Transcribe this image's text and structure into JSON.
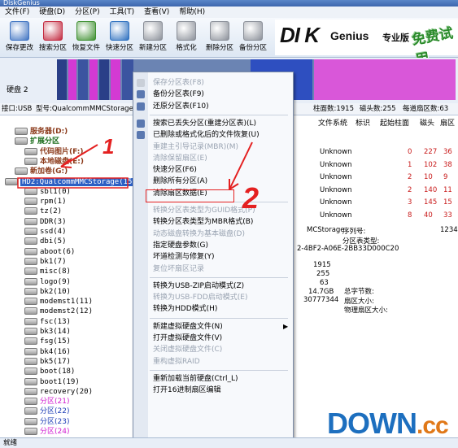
{
  "window": {
    "title": "DiskGenius"
  },
  "menubar": [
    "文件(F)",
    "硬盘(D)",
    "分区(P)",
    "工具(T)",
    "查看(V)",
    "帮助(H)"
  ],
  "toolbar": [
    {
      "label": "保存更改",
      "icon": "save-icon",
      "color": "#3f73c2"
    },
    {
      "label": "搜索分区",
      "icon": "search-partition-icon",
      "color": "#c2283e"
    },
    {
      "label": "恢复文件",
      "icon": "recover-files-icon",
      "color": "#3d8f2f"
    },
    {
      "label": "快速分区",
      "icon": "quick-partition-icon",
      "color": "#2c6fbf"
    },
    {
      "label": "新建分区",
      "icon": "new-partition-icon",
      "color": "#8a8f98"
    },
    {
      "label": "格式化",
      "icon": "format-icon",
      "color": "#8a8f98"
    },
    {
      "label": "删除分区",
      "icon": "delete-partition-icon",
      "color": "#8a8f98"
    },
    {
      "label": "备份分区",
      "icon": "backup-partition-icon",
      "color": "#8a8f98"
    }
  ],
  "brand": {
    "dk": "DI K",
    "gen": "Genius",
    "pro": "专业版",
    "free": "免费试用"
  },
  "disk": {
    "label": "硬盘 2"
  },
  "infobar": {
    "iface": "接口:USB",
    "model": "型号:QualcommMMCStorage",
    "cyl": "柱面数:1915",
    "heads": "磁头数:255",
    "spt": "每道扇区数:63"
  },
  "tree": [
    {
      "text": "服务器(D:)",
      "cls": "c-brown",
      "indent": 18,
      "hd": true
    },
    {
      "text": "扩展分区",
      "cls": "c-green",
      "indent": 18,
      "hd": true
    },
    {
      "text": "代码图片(F:)",
      "cls": "c-brown",
      "indent": 30,
      "hd": true
    },
    {
      "text": "本地磁盘(E:)",
      "cls": "c-brown",
      "indent": 30,
      "hd": true
    },
    {
      "text": "新加卷(G:)",
      "cls": "c-brown",
      "indent": 18,
      "hd": true
    },
    {
      "text": "HD2:QualcommMMCStorage(15GB)",
      "cls": "c-mono",
      "indent": 6,
      "hd": true,
      "sel": true
    },
    {
      "text": "sbl1(0)",
      "cls": "c-mono",
      "indent": 30,
      "hd": true
    },
    {
      "text": "rpm(1)",
      "cls": "c-mono",
      "indent": 30,
      "hd": true
    },
    {
      "text": "tz(2)",
      "cls": "c-mono",
      "indent": 30,
      "hd": true
    },
    {
      "text": "DDR(3)",
      "cls": "c-mono",
      "indent": 30,
      "hd": true
    },
    {
      "text": "ssd(4)",
      "cls": "c-mono",
      "indent": 30,
      "hd": true
    },
    {
      "text": "dbi(5)",
      "cls": "c-mono",
      "indent": 30,
      "hd": true
    },
    {
      "text": "aboot(6)",
      "cls": "c-mono",
      "indent": 30,
      "hd": true
    },
    {
      "text": "bk1(7)",
      "cls": "c-mono",
      "indent": 30,
      "hd": true
    },
    {
      "text": "misc(8)",
      "cls": "c-mono",
      "indent": 30,
      "hd": true
    },
    {
      "text": "logo(9)",
      "cls": "c-mono",
      "indent": 30,
      "hd": true
    },
    {
      "text": "bk2(10)",
      "cls": "c-mono",
      "indent": 30,
      "hd": true
    },
    {
      "text": "modemst1(11)",
      "cls": "c-mono",
      "indent": 30,
      "hd": true
    },
    {
      "text": "modemst2(12)",
      "cls": "c-mono",
      "indent": 30,
      "hd": true
    },
    {
      "text": "fsc(13)",
      "cls": "c-mono",
      "indent": 30,
      "hd": true
    },
    {
      "text": "bk3(14)",
      "cls": "c-mono",
      "indent": 30,
      "hd": true
    },
    {
      "text": "fsg(15)",
      "cls": "c-mono",
      "indent": 30,
      "hd": true
    },
    {
      "text": "bk4(16)",
      "cls": "c-mono",
      "indent": 30,
      "hd": true
    },
    {
      "text": "bk5(17)",
      "cls": "c-mono",
      "indent": 30,
      "hd": true
    },
    {
      "text": "boot(18)",
      "cls": "c-mono",
      "indent": 30,
      "hd": true
    },
    {
      "text": "boot1(19)",
      "cls": "c-mono",
      "indent": 30,
      "hd": true
    },
    {
      "text": "recovery(20)",
      "cls": "c-mono",
      "indent": 30,
      "hd": true
    },
    {
      "text": "分区(21)",
      "cls": "c-mag",
      "indent": 30,
      "hd": true
    },
    {
      "text": "分区(22)",
      "cls": "c-blue",
      "indent": 30,
      "hd": true
    },
    {
      "text": "分区(23)",
      "cls": "c-blue",
      "indent": 30,
      "hd": true
    },
    {
      "text": "分区(24)",
      "cls": "c-mag",
      "indent": 30,
      "hd": true
    }
  ],
  "table": {
    "headers": [
      "文件系统",
      "标识",
      "起始柱面",
      "磁头",
      "扇区"
    ],
    "rows": [
      [
        "Unknown",
        "",
        "0",
        "227",
        "36"
      ],
      [
        "Unknown",
        "",
        "1",
        "102",
        "38"
      ],
      [
        "Unknown",
        "",
        "2",
        "10",
        "9"
      ],
      [
        "Unknown",
        "",
        "2",
        "140",
        "11"
      ],
      [
        "Unknown",
        "",
        "3",
        "145",
        "15"
      ],
      [
        "Unknown",
        "",
        "8",
        "40",
        "33"
      ]
    ]
  },
  "details": {
    "serial_label": "序列号:",
    "serial_value": "1234",
    "pt_label": "分区表类型:",
    "model_frag": "MCStorage",
    "guid_frag": "2-4BF2-A06E-2BB33D000C20",
    "cyl": "1915",
    "heads": "255",
    "spt": "63",
    "size": "14.7GB",
    "sectors": "30777344",
    "total_bytes_label": "总字节数:",
    "sector_size_label": "扇区大小:",
    "phys_sector_label": "物理扇区大小:"
  },
  "context_menu": [
    {
      "label": "保存分区表(F8)",
      "disabled": true,
      "icon": "save-icon"
    },
    {
      "label": "备份分区表(F9)",
      "disabled": false,
      "icon": "backup-icon"
    },
    {
      "label": "还原分区表(F10)",
      "disabled": false,
      "icon": "restore-icon"
    },
    {
      "sep": true
    },
    {
      "label": "搜索已丢失分区(重建分区表)(L)",
      "disabled": false,
      "icon": "search-icon"
    },
    {
      "label": "已删除或格式化后的文件恢复(U)",
      "disabled": false,
      "icon": "recover-icon"
    },
    {
      "label": "重建主引导记录(MBR)(M)",
      "disabled": true
    },
    {
      "label": "清除保留扇区(E)",
      "disabled": true
    },
    {
      "label": "快速分区(F6)",
      "disabled": false
    },
    {
      "label": "删除所有分区(A)",
      "disabled": false
    },
    {
      "label": "清除扇区数据(E)",
      "disabled": false
    },
    {
      "sep": true
    },
    {
      "label": "转换分区表类型为GUID格式(P)",
      "disabled": true
    },
    {
      "label": "转换分区表类型为MBR格式(B)",
      "disabled": false
    },
    {
      "label": "动态磁盘转换为基本磁盘(D)",
      "disabled": true
    },
    {
      "label": "指定硬盘参数(G)",
      "disabled": false
    },
    {
      "label": "坏道检测与修复(Y)",
      "disabled": false
    },
    {
      "label": "复位坏扇区记录",
      "disabled": true
    },
    {
      "sep": true
    },
    {
      "label": "转换为USB-ZIP启动模式(Z)",
      "disabled": false
    },
    {
      "label": "转换为USB-FDD启动模式(E)",
      "disabled": true
    },
    {
      "label": "转换为HDD模式(H)",
      "disabled": false
    },
    {
      "sep": true
    },
    {
      "label": "新建虚拟硬盘文件(N)",
      "disabled": false,
      "submenu": true
    },
    {
      "label": "打开虚拟硬盘文件(V)",
      "disabled": false
    },
    {
      "label": "关闭虚拟硬盘文件(C)",
      "disabled": true
    },
    {
      "label": "重构虚拟RAID",
      "disabled": true
    },
    {
      "sep": true
    },
    {
      "label": "重新加载当前硬盘(Ctrl_L)",
      "disabled": false
    },
    {
      "label": "打开16进制扇区编辑",
      "disabled": false
    }
  ],
  "annotations": {
    "one": "1",
    "two": "2"
  },
  "status": {
    "text": "就绪"
  },
  "watermark": {
    "main": "DOWN",
    "tld": ".cc"
  }
}
